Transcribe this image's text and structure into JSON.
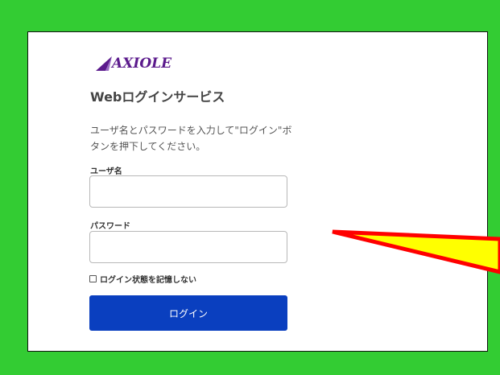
{
  "brand": {
    "logo_text": "AXIOLE"
  },
  "login": {
    "title": "Webログインサービス",
    "instructions": "ユーザ名とパスワードを入力して\"ログイン\"ボタンを押下してください。",
    "username_label": "ユーザ名",
    "username_value": "",
    "password_label": "パスワード",
    "password_value": "",
    "remember_label": "ログイン状態を記憶しない",
    "remember_checked": false,
    "submit_label": "ログイン"
  },
  "colors": {
    "background": "#33cc33",
    "button": "#0a3fbf",
    "logo": "#5b1a8c",
    "arrow_fill": "#ffff00",
    "arrow_outline": "#ff0000"
  }
}
